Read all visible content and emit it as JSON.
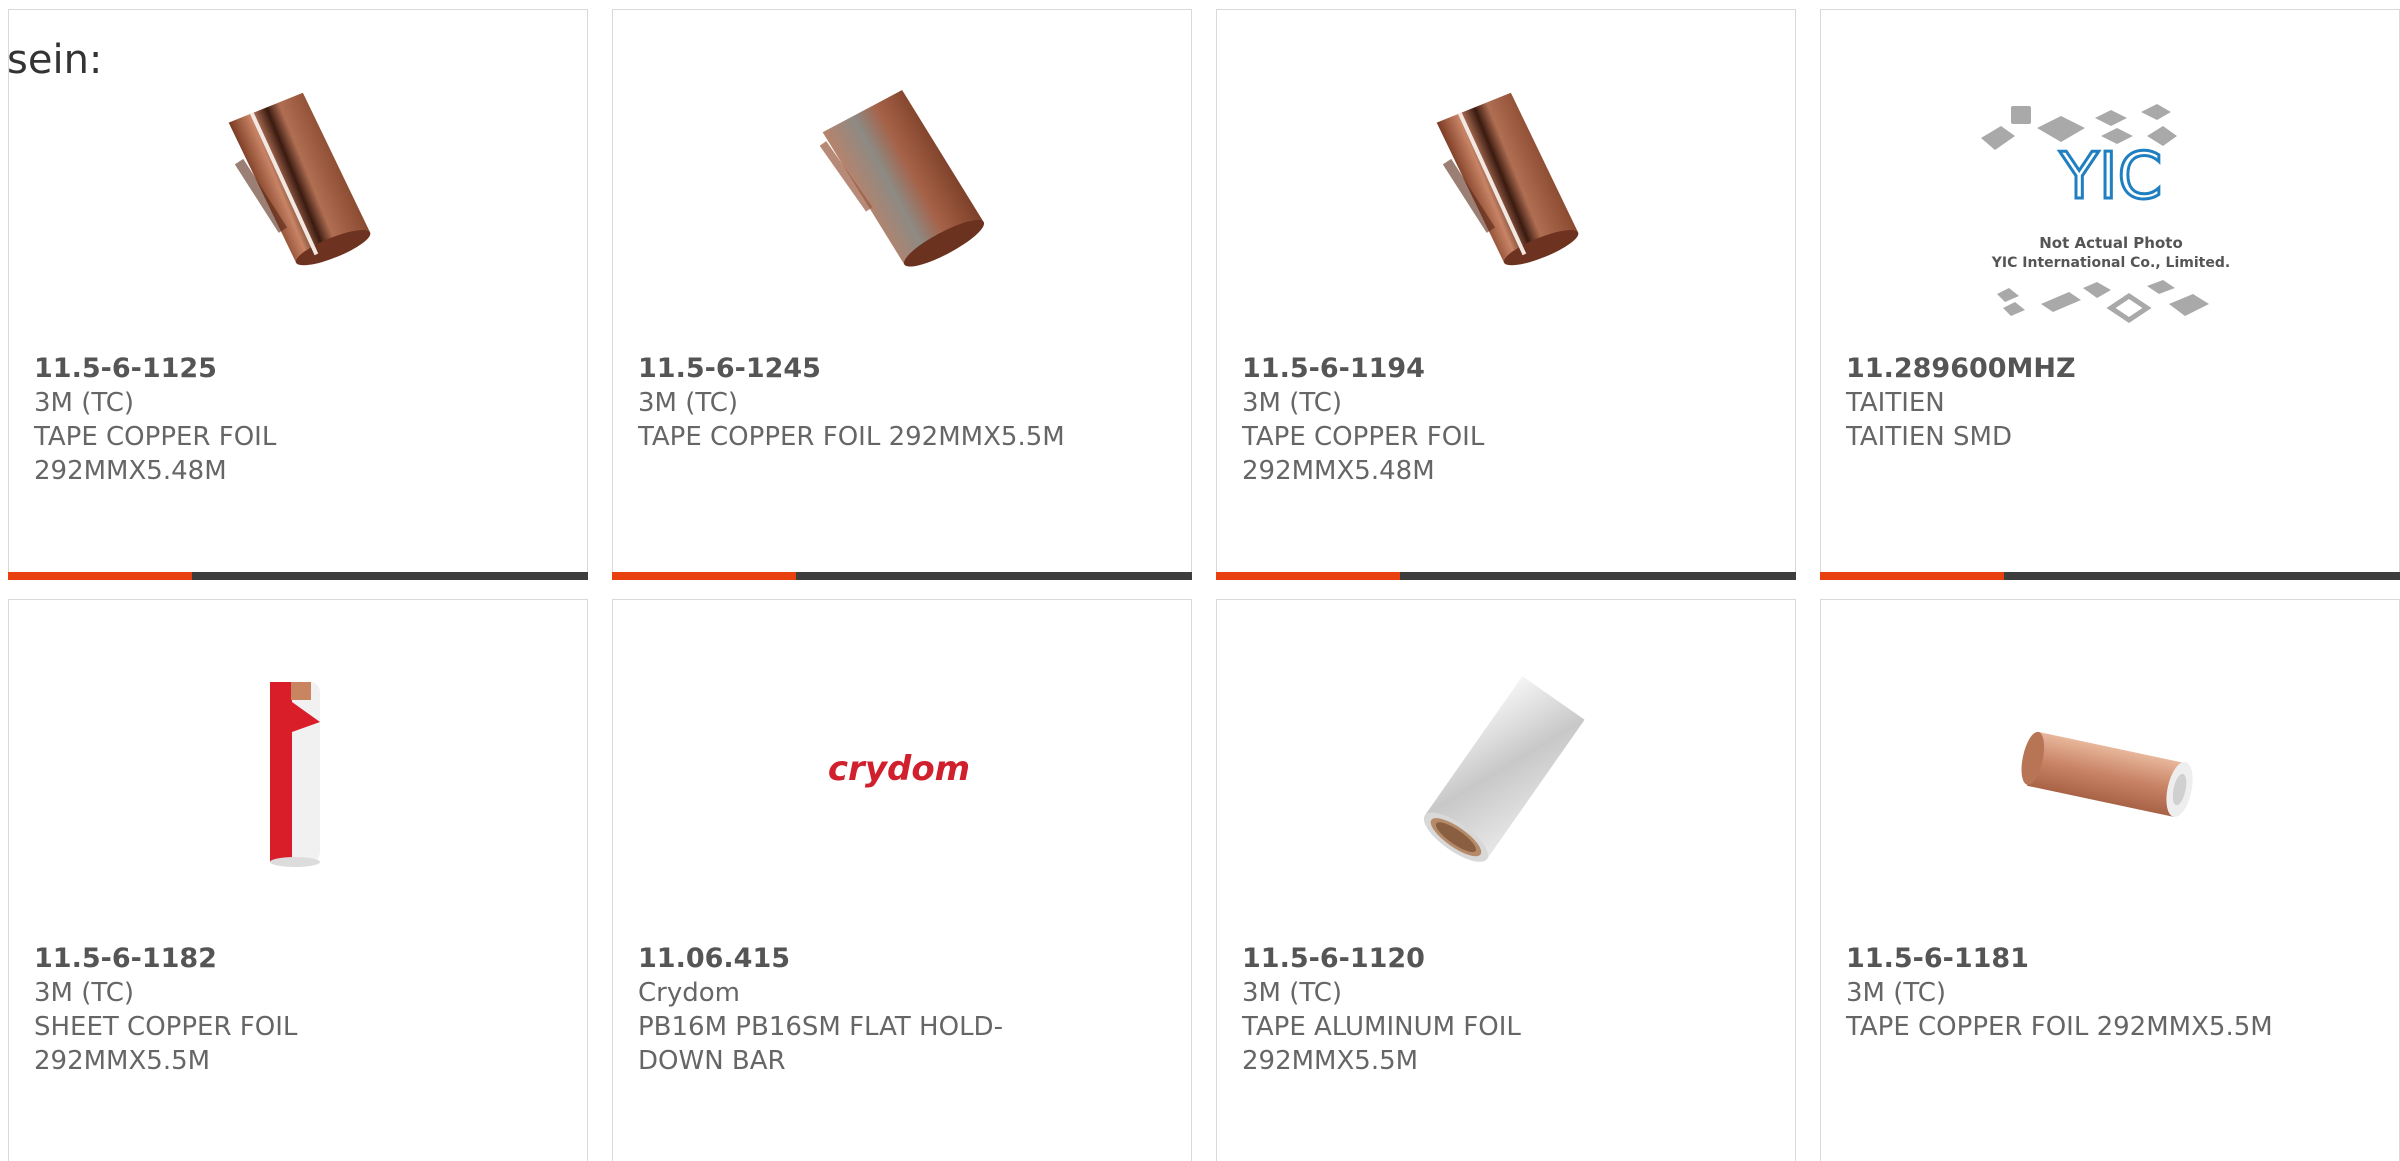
{
  "page_fragment": "sein:",
  "colors": {
    "accent": "#e8400f",
    "bar_dark": "#3d3d3d",
    "text": "#666666",
    "border": "#d9d9d9"
  },
  "products": [
    {
      "part_number": "11.5-6-1125",
      "manufacturer": "3M (TC)",
      "description": "TAPE COPPER FOIL 292MMX5.48M",
      "image": "copper-foil-tape-roll",
      "has_bar": true
    },
    {
      "part_number": "11.5-6-1245",
      "manufacturer": "3M (TC)",
      "description": "TAPE COPPER FOIL 292MMX5.5M",
      "image": "copper-foil-tape-roll",
      "has_bar": true
    },
    {
      "part_number": "11.5-6-1194",
      "manufacturer": "3M (TC)",
      "description": "TAPE COPPER FOIL 292MMX5.48M",
      "image": "copper-foil-tape-roll",
      "has_bar": true
    },
    {
      "part_number": "11.289600MHZ",
      "manufacturer": "TAITIEN",
      "description": "TAITIEN SMD",
      "image": "not-actual-photo-placeholder",
      "image_text": [
        "YIC",
        "Not Actual Photo",
        "YIC International Co., Limited."
      ],
      "has_bar": true
    },
    {
      "part_number": "11.5-6-1182",
      "manufacturer": "3M (TC)",
      "description": "SHEET COPPER FOIL 292MMX5.5M",
      "image": "copper-sheet-roll",
      "has_bar": false
    },
    {
      "part_number": "11.06.415",
      "manufacturer": "Crydom",
      "description": "PB16M PB16SM FLAT HOLD-DOWN BAR",
      "image": "crydom-logo",
      "image_text": [
        "crydom"
      ],
      "has_bar": false
    },
    {
      "part_number": "11.5-6-1120",
      "manufacturer": "3M (TC)",
      "description": "TAPE ALUMINUM FOIL 292MMX5.5M",
      "image": "aluminum-foil-tape-roll",
      "has_bar": false
    },
    {
      "part_number": "11.5-6-1181",
      "manufacturer": "3M (TC)",
      "description": "TAPE COPPER FOIL 292MMX5.5M",
      "image": "copper-foil-tape-roll",
      "has_bar": false
    }
  ]
}
